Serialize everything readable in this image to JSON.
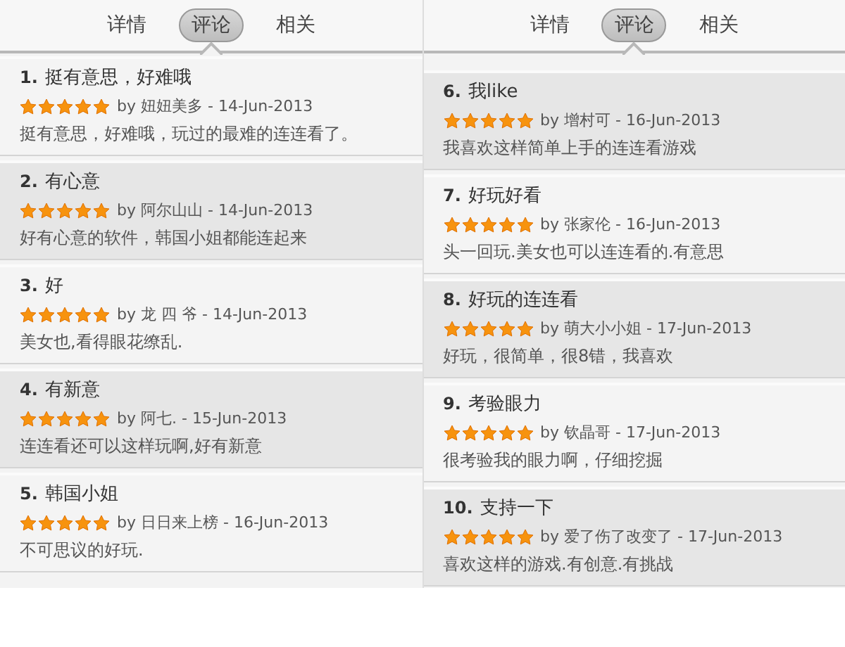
{
  "panels": [
    {
      "tabs": [
        {
          "label": "详情",
          "selected": false
        },
        {
          "label": "评论",
          "selected": true
        },
        {
          "label": "相关",
          "selected": false
        }
      ],
      "reviews": [
        {
          "number": "1.",
          "title": "挺有意思，好难哦",
          "stars": 5,
          "byline": "by 妞妞美多 - 14-Jun-2013",
          "body": "挺有意思，好难哦，玩过的最难的连连看了。"
        },
        {
          "number": "2.",
          "title": "有心意",
          "stars": 5,
          "byline": "by 阿尔山山 - 14-Jun-2013",
          "body": "好有心意的软件，韩国小姐都能连起来"
        },
        {
          "number": "3.",
          "title": "好",
          "stars": 5,
          "byline": "by 龙 四 爷 - 14-Jun-2013",
          "body": "美女也,看得眼花缭乱."
        },
        {
          "number": "4.",
          "title": "有新意",
          "stars": 5,
          "byline": "by 阿七. - 15-Jun-2013",
          "body": "连连看还可以这样玩啊,好有新意"
        },
        {
          "number": "5.",
          "title": "韩国小姐",
          "stars": 5,
          "byline": "by 日日来上榜 - 16-Jun-2013",
          "body": "不可思议的好玩."
        }
      ]
    },
    {
      "tabs": [
        {
          "label": "详情",
          "selected": false
        },
        {
          "label": "评论",
          "selected": true
        },
        {
          "label": "相关",
          "selected": false
        }
      ],
      "reviews": [
        {
          "number": "6.",
          "title": "我like",
          "stars": 5,
          "byline": "by 增村可 - 16-Jun-2013",
          "body": "我喜欢这样简单上手的连连看游戏"
        },
        {
          "number": "7.",
          "title": "好玩好看",
          "stars": 5,
          "byline": "by 张家伦 - 16-Jun-2013",
          "body": "头一回玩.美女也可以连连看的.有意思"
        },
        {
          "number": "8.",
          "title": "好玩的连连看",
          "stars": 5,
          "byline": "by 萌大小小姐 - 17-Jun-2013",
          "body": "好玩，很简单，很8错，我喜欢"
        },
        {
          "number": "9.",
          "title": "考验眼力",
          "stars": 5,
          "byline": "by 钦晶哥 - 17-Jun-2013",
          "body": "很考验我的眼力啊，仔细挖掘"
        },
        {
          "number": "10.",
          "title": "支持一下",
          "stars": 5,
          "byline": "by 爱了伤了改变了 - 17-Jun-2013",
          "body": "喜欢这样的游戏.有创意.有挑战"
        }
      ]
    }
  ]
}
